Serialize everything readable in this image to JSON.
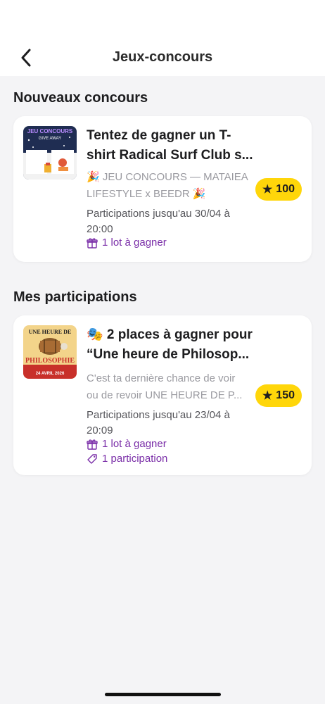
{
  "header": {
    "title": "Jeux-concours"
  },
  "sections": {
    "new": {
      "title": "Nouveaux concours"
    },
    "mine": {
      "title": "Mes participations"
    }
  },
  "cards": [
    {
      "title_lines": [
        "Tentez de gagner un T-",
        "shirt Radical Surf Club s..."
      ],
      "desc_lines": [
        "🎉 JEU CONCOURS — MATAIEA",
        "LIFESTYLE x BEEDR 🎉"
      ],
      "deadline": "Participations jusqu'au 30/04 à 20:00",
      "lots": "1 lot à gagner",
      "points": "100",
      "thumb": {
        "line1": "JEU CONCOURS",
        "line2": "GIVE AWAY"
      }
    },
    {
      "title_lines": [
        "🎭 2 places à gagner pour",
        "“Une heure de Philosop..."
      ],
      "desc_lines": [
        "C'est ta dernière chance de voir",
        "ou de revoir UNE HEURE DE P..."
      ],
      "deadline": "Participations jusqu'au 23/04 à 20:09",
      "lots": "1 lot à gagner",
      "participations": "1 participation",
      "points": "150",
      "thumb": {
        "line1": "UNE HEURE DE",
        "line2": "PHILOSOPHIE",
        "line3": "24 AVRIL 2026"
      }
    }
  ],
  "colors": {
    "accent": "#7a2ea8",
    "badge": "#ffd60a",
    "background": "#f4f4f6"
  },
  "icons": {
    "back": "chevron-left-icon",
    "gift": "gift-icon",
    "ticket": "ticket-icon",
    "star": "star-icon"
  }
}
